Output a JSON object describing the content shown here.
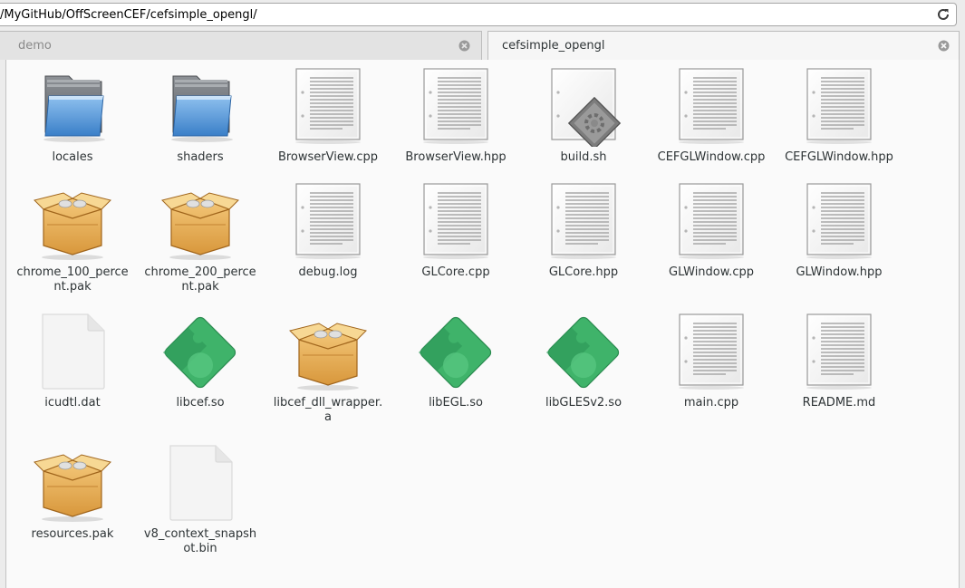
{
  "location": {
    "path": "/MyGitHub/OffScreenCEF/cefsimple_opengl/"
  },
  "tabs": [
    {
      "label": "demo"
    },
    {
      "label": "cefsimple_opengl"
    }
  ],
  "files": [
    {
      "name": "locales",
      "icon": "folder-icon"
    },
    {
      "name": "shaders",
      "icon": "folder-icon"
    },
    {
      "name": "BrowserView.cpp",
      "icon": "text-file-icon"
    },
    {
      "name": "BrowserView.hpp",
      "icon": "text-file-icon"
    },
    {
      "name": "build.sh",
      "icon": "script-file-icon"
    },
    {
      "name": "CEFGLWindow.cpp",
      "icon": "text-file-icon"
    },
    {
      "name": "CEFGLWindow.hpp",
      "icon": "text-file-icon"
    },
    {
      "name": "chrome_100_percent.pak",
      "icon": "package-icon"
    },
    {
      "name": "chrome_200_percent.pak",
      "icon": "package-icon"
    },
    {
      "name": "debug.log",
      "icon": "text-file-icon"
    },
    {
      "name": "GLCore.cpp",
      "icon": "text-file-icon"
    },
    {
      "name": "GLCore.hpp",
      "icon": "text-file-icon"
    },
    {
      "name": "GLWindow.cpp",
      "icon": "text-file-icon"
    },
    {
      "name": "GLWindow.hpp",
      "icon": "text-file-icon"
    },
    {
      "name": "icudtl.dat",
      "icon": "blank-file-icon"
    },
    {
      "name": "libcef.so",
      "icon": "shared-library-icon"
    },
    {
      "name": "libcef_dll_wrapper.a",
      "icon": "package-icon"
    },
    {
      "name": "libEGL.so",
      "icon": "shared-library-icon"
    },
    {
      "name": "libGLESv2.so",
      "icon": "shared-library-icon"
    },
    {
      "name": "main.cpp",
      "icon": "text-file-icon"
    },
    {
      "name": "README.md",
      "icon": "text-file-icon"
    },
    {
      "name": "resources.pak",
      "icon": "package-icon"
    },
    {
      "name": "v8_context_snapshot.bin",
      "icon": "blank-file-icon"
    }
  ]
}
